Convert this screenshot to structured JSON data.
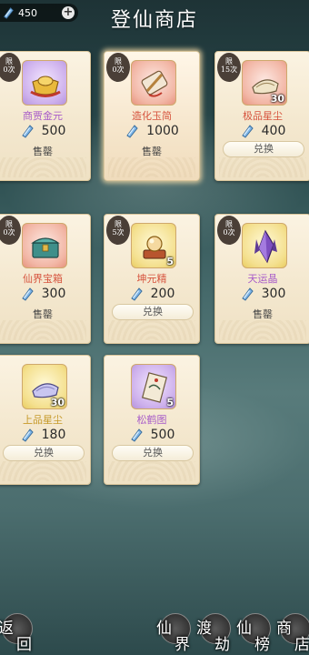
{
  "header": {
    "title": "登仙商店",
    "currency_amount": "450",
    "currency_icon": "spirit-gem-icon"
  },
  "items": [
    {
      "name": "商贾金元",
      "limit": "限 0次",
      "price": "500",
      "status": "售罄",
      "count": "",
      "bg": "purple",
      "name_color": "purple",
      "icon": "gold-ingot-icon"
    },
    {
      "name": "造化玉简",
      "limit": "限 0次",
      "price": "1000",
      "status": "售罄",
      "count": "",
      "bg": "red",
      "name_color": "red",
      "icon": "jade-scroll-icon"
    },
    {
      "name": "极品星尘",
      "limit": "限 15次",
      "price": "400",
      "status": "兑换",
      "count": "30",
      "bg": "red",
      "name_color": "red",
      "icon": "star-dust-icon"
    },
    {
      "name": "仙界宝箱",
      "limit": "限 0次",
      "price": "300",
      "status": "售罄",
      "count": "",
      "bg": "red",
      "name_color": "red",
      "icon": "treasure-chest-icon"
    },
    {
      "name": "坤元精",
      "limit": "限 5次",
      "price": "200",
      "status": "兑换",
      "count": "5",
      "bg": "yellow",
      "name_color": "red",
      "icon": "crystal-orb-icon"
    },
    {
      "name": "天运晶",
      "limit": "限 0次",
      "price": "300",
      "status": "售罄",
      "count": "",
      "bg": "yellow",
      "name_color": "purple",
      "icon": "purple-crystal-icon"
    },
    {
      "name": "上品星尘",
      "limit": "",
      "price": "180",
      "status": "兑换",
      "count": "30",
      "bg": "yellow",
      "name_color": "gold",
      "icon": "star-dust-icon"
    },
    {
      "name": "松鹤图",
      "limit": "",
      "price": "500",
      "status": "兑换",
      "count": "5",
      "bg": "purple",
      "name_color": "purple",
      "icon": "painting-scroll-icon"
    }
  ],
  "bottom_nav": {
    "back": [
      "返",
      "回"
    ],
    "buttons": [
      {
        "c1": "仙",
        "c2": "界"
      },
      {
        "c1": "渡",
        "c2": "劫"
      },
      {
        "c1": "仙",
        "c2": "榜"
      },
      {
        "c1": "商",
        "c2": "店"
      }
    ]
  },
  "colors": {
    "background_top": "#1e3336",
    "card_bg": "#f4e8cf",
    "name_purple": "#a85cc9",
    "name_red": "#d6543e",
    "name_gold": "#c69a2a"
  }
}
